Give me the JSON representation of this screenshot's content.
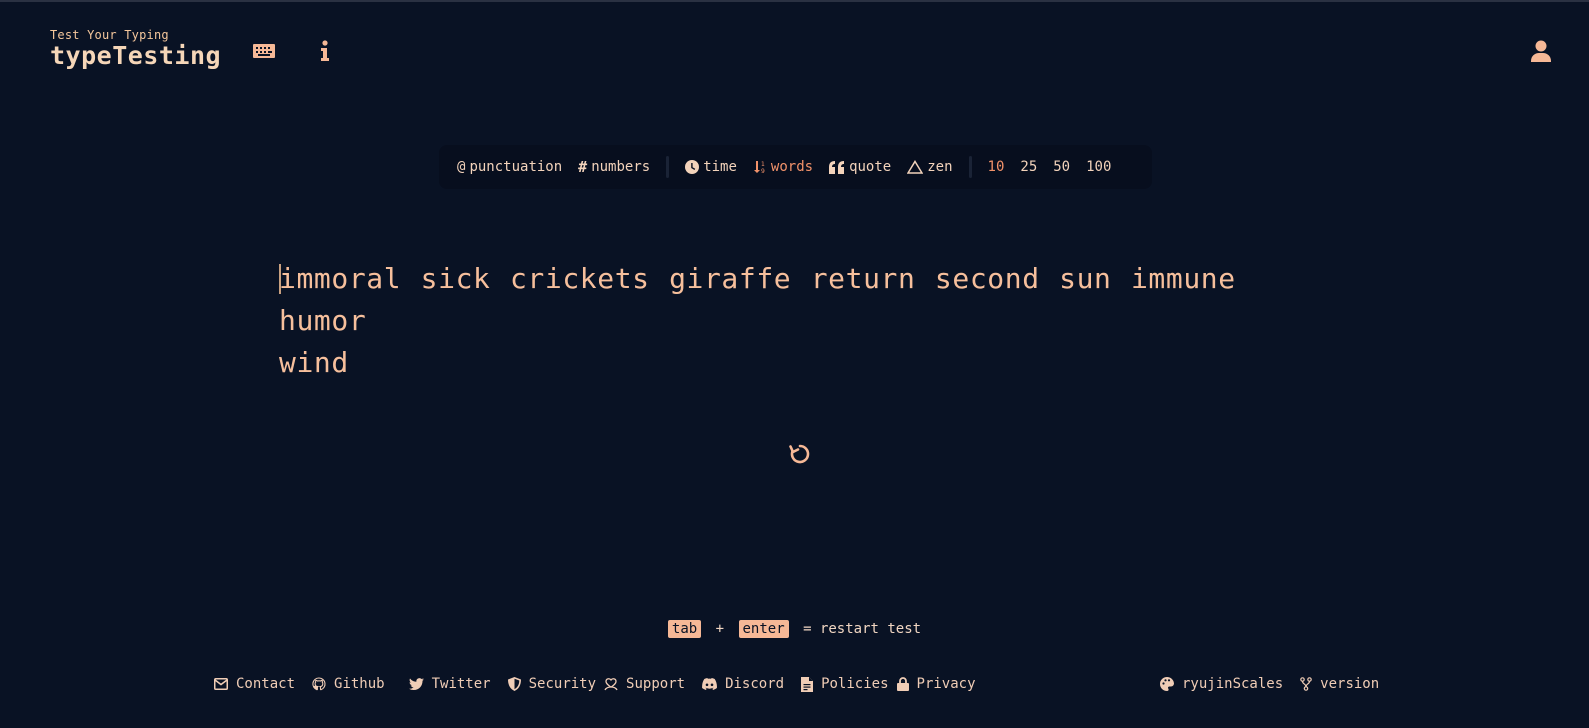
{
  "header": {
    "subtitle": "Test Your Typing",
    "title": "typeTesting",
    "keyboard_icon": "keyboard-icon",
    "info_icon": "info-icon",
    "account_icon": "user-icon"
  },
  "config": {
    "toggles": [
      {
        "label": "punctuation",
        "icon": "at-icon"
      },
      {
        "label": "numbers",
        "icon": "hash-icon"
      }
    ],
    "modes": [
      {
        "label": "time",
        "icon": "clock-icon",
        "active": false
      },
      {
        "label": "words",
        "icon": "sort-numeric-icon",
        "active": true
      },
      {
        "label": "quote",
        "icon": "quote-icon",
        "active": false
      },
      {
        "label": "zen",
        "icon": "triangle-icon",
        "active": false
      }
    ],
    "counts": [
      {
        "label": "10",
        "active": true
      },
      {
        "label": "25",
        "active": false
      },
      {
        "label": "50",
        "active": false
      },
      {
        "label": "100",
        "active": false
      }
    ]
  },
  "test": {
    "line1": "immoral sick crickets giraffe return second sun immune humor",
    "line2": "wind"
  },
  "hint": {
    "key1": "tab",
    "plus": "+",
    "key2": "enter",
    "text": "= restart test"
  },
  "footer": {
    "links": [
      {
        "label": "Contact",
        "icon": "mail-icon"
      },
      {
        "label": "Github",
        "icon": "github-icon"
      },
      {
        "label": "Twitter",
        "icon": "twitter-icon"
      },
      {
        "label": "Security",
        "icon": "shield-icon"
      },
      {
        "label": "Support",
        "icon": "donate-icon"
      },
      {
        "label": "Discord",
        "icon": "discord-icon"
      },
      {
        "label": "Policies",
        "icon": "document-icon"
      },
      {
        "label": "Privacy",
        "icon": "lock-icon"
      }
    ],
    "theme": "ryujinScales",
    "version": "version"
  },
  "colors": {
    "background": "#091224",
    "accent": "#f6b896",
    "active": "#f1926a",
    "text": "#f3d3bb"
  }
}
